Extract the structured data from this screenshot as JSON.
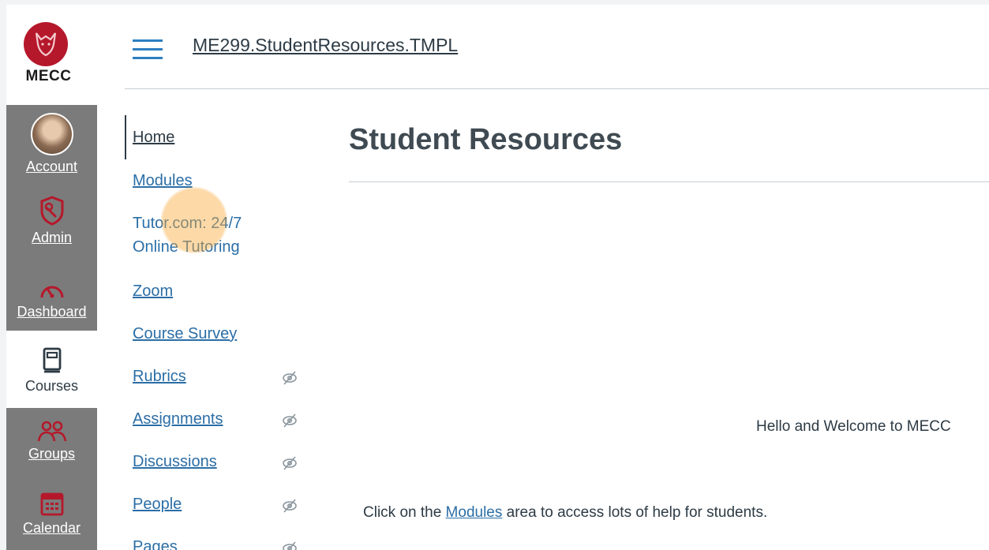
{
  "brand": {
    "logo_text": "MECC",
    "logo_color": "#b5182b"
  },
  "global_nav": {
    "items": [
      {
        "label": "Account",
        "icon": "user-avatar"
      },
      {
        "label": "Admin",
        "icon": "shield-icon"
      },
      {
        "label": "Dashboard",
        "icon": "dashboard-icon"
      },
      {
        "label": "Courses",
        "icon": "courses-book-icon",
        "active": true
      },
      {
        "label": "Groups",
        "icon": "groups-icon"
      },
      {
        "label": "Calendar",
        "icon": "calendar-icon"
      }
    ]
  },
  "header": {
    "breadcrumb": "ME299.StudentResources.TMPL"
  },
  "course_nav": {
    "items": [
      {
        "label": "Home",
        "hidden": false
      },
      {
        "label": "Modules",
        "hidden": false
      },
      {
        "label": "Tutor.com: 24/7",
        "hidden": false
      },
      {
        "label": "Online Tutoring",
        "hidden": false
      },
      {
        "label": "Zoom",
        "hidden": false
      },
      {
        "label": "Course Survey",
        "hidden": false
      },
      {
        "label": "Rubrics",
        "hidden": true
      },
      {
        "label": "Assignments",
        "hidden": true
      },
      {
        "label": "Discussions",
        "hidden": true
      },
      {
        "label": "People",
        "hidden": true
      },
      {
        "label": "Pages",
        "hidden": true
      }
    ]
  },
  "main": {
    "title": "Student Resources",
    "welcome": "Hello and Welcome to MECC",
    "paragraph": {
      "before": "Click on the ",
      "link": "Modules",
      "after": " area to access lots of help for students."
    }
  },
  "colors": {
    "link": "#2b6ea6",
    "nav_gray": "#7b7b7b",
    "hamburger": "#2d7fc1",
    "click_highlight": "#f9aa3c"
  }
}
